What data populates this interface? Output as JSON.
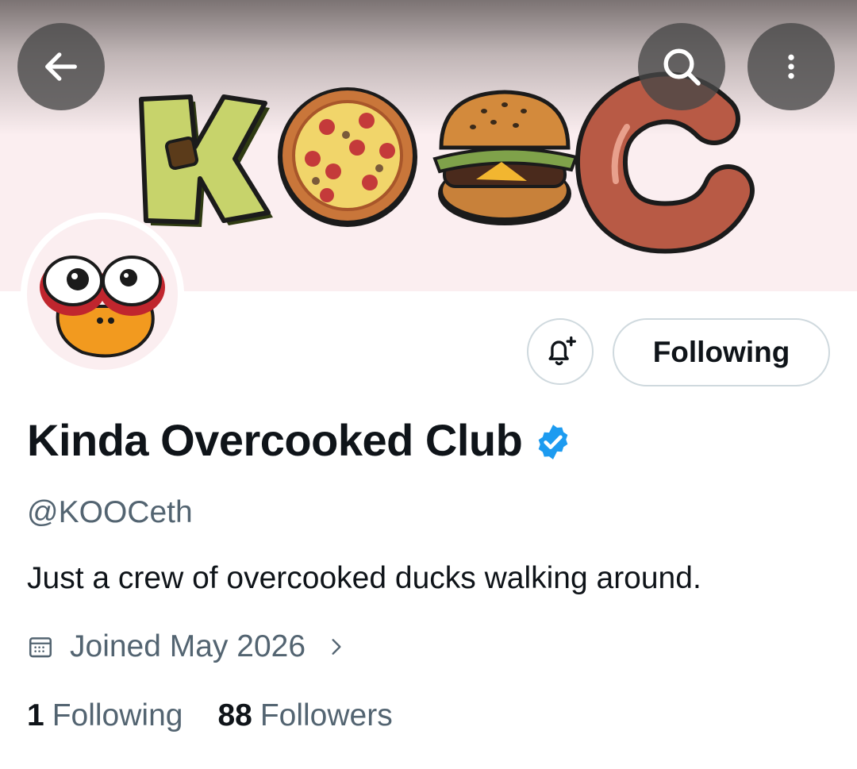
{
  "header": {
    "back_icon": "arrow-left-icon",
    "search_icon": "search-icon",
    "more_icon": "more-vertical-icon",
    "banner_text": "KOOC"
  },
  "profile": {
    "display_name": "Kinda Overcooked Club",
    "verified": true,
    "handle": "@KOOCeth",
    "bio": "Just a crew of overcooked ducks walking around.",
    "joined": "Joined May 2026",
    "following_count": "1",
    "following_label": "Following",
    "followers_count": "88",
    "followers_label": "Followers"
  },
  "actions": {
    "follow_button_label": "Following",
    "notify_icon": "bell-plus-icon"
  },
  "colors": {
    "verified_blue": "#1d9bf0",
    "secondary_text": "#536471",
    "banner_bg": "#fbeef0"
  }
}
